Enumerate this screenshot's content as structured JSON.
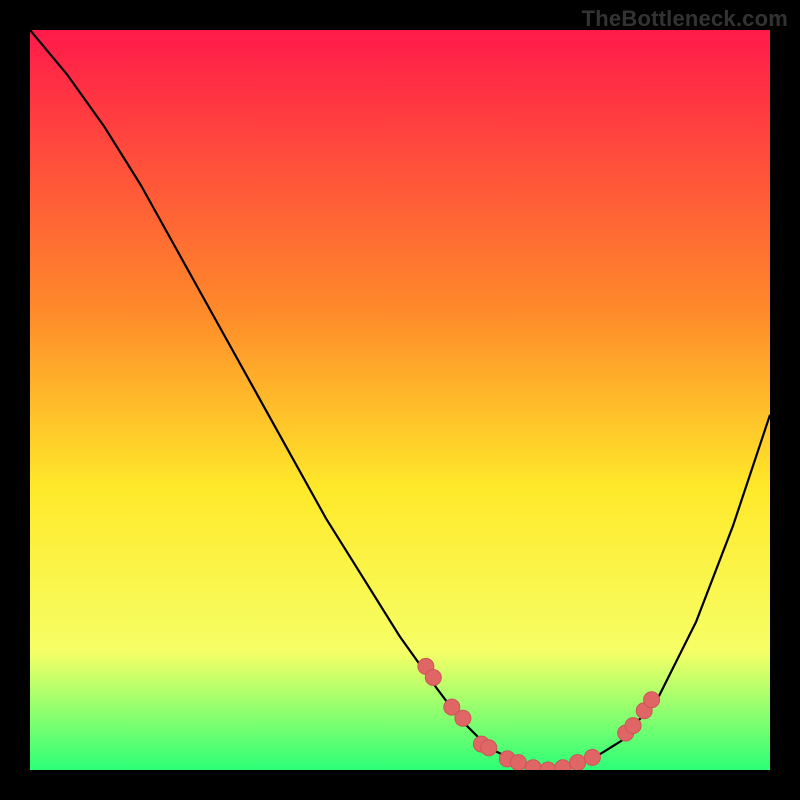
{
  "watermark": "TheBottleneck.com",
  "colors": {
    "gradient_top": "#ff1a4a",
    "gradient_mid1": "#ff8a2a",
    "gradient_mid2": "#ffe92a",
    "gradient_mid3": "#f6ff66",
    "gradient_bottom": "#2cff77",
    "curve": "#000000",
    "marker_fill": "#e06666",
    "marker_stroke": "#cc5555"
  },
  "chart_data": {
    "type": "line",
    "title": "",
    "xlabel": "",
    "ylabel": "",
    "xlim": [
      0,
      100
    ],
    "ylim": [
      0,
      100
    ],
    "series": [
      {
        "name": "bottleneck-curve",
        "x": [
          0,
          5,
          10,
          15,
          20,
          25,
          30,
          35,
          40,
          45,
          50,
          55,
          58,
          60,
          62,
          65,
          68,
          70,
          73,
          76,
          80,
          85,
          90,
          95,
          100
        ],
        "y": [
          100,
          94,
          87,
          79,
          70,
          61,
          52,
          43,
          34,
          26,
          18,
          11,
          7,
          5,
          3,
          1.5,
          0.5,
          0,
          0.5,
          1.5,
          4,
          10,
          20,
          33,
          48
        ]
      }
    ],
    "markers": {
      "name": "highlight-points",
      "x": [
        53.5,
        54.5,
        57,
        58.5,
        61,
        62,
        64.5,
        66,
        68,
        70,
        72,
        74,
        76,
        80.5,
        81.5,
        83,
        84
      ],
      "y": [
        14,
        12.5,
        8.5,
        7,
        3.5,
        3,
        1.5,
        1,
        0.3,
        0,
        0.3,
        1,
        1.7,
        5,
        6,
        8,
        9.5
      ]
    }
  }
}
